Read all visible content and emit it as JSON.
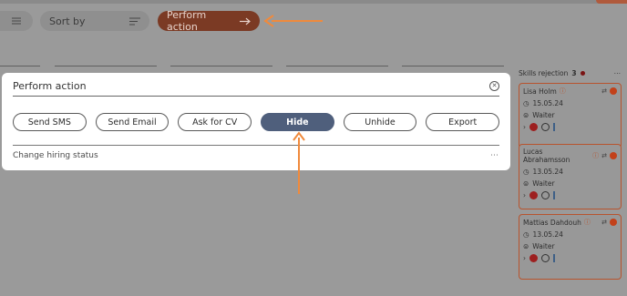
{
  "toolbar": {
    "sort_label": "Sort by",
    "perform_label": "Perform action"
  },
  "column": {
    "title": "Skills rejection",
    "count": "3"
  },
  "cards": [
    {
      "name": "Lisa Holm",
      "date": "15.05.24",
      "role": "Waiter"
    },
    {
      "name": "Lucas Abrahamsson",
      "date": "13.05.24",
      "role": "Waiter"
    },
    {
      "name": "Mattias Dahdouh",
      "date": "13.05.24",
      "role": "Waiter"
    }
  ],
  "modal": {
    "title": "Perform action",
    "actions": [
      {
        "label": "Send SMS"
      },
      {
        "label": "Send Email"
      },
      {
        "label": "Ask for CV"
      },
      {
        "label": "Hide"
      },
      {
        "label": "Unhide"
      },
      {
        "label": "Export"
      }
    ],
    "footer_label": "Change hiring status"
  },
  "colors": {
    "accent": "#c2411a",
    "primary_active": "#4f5f7c",
    "annotation_arrow": "#f08a3c"
  },
  "icons": [
    "filter-icon",
    "sort-icon",
    "arrow-right-icon",
    "close-icon",
    "info-icon",
    "clock-icon",
    "briefcase-icon",
    "chevron-right-icon",
    "more-icon"
  ]
}
